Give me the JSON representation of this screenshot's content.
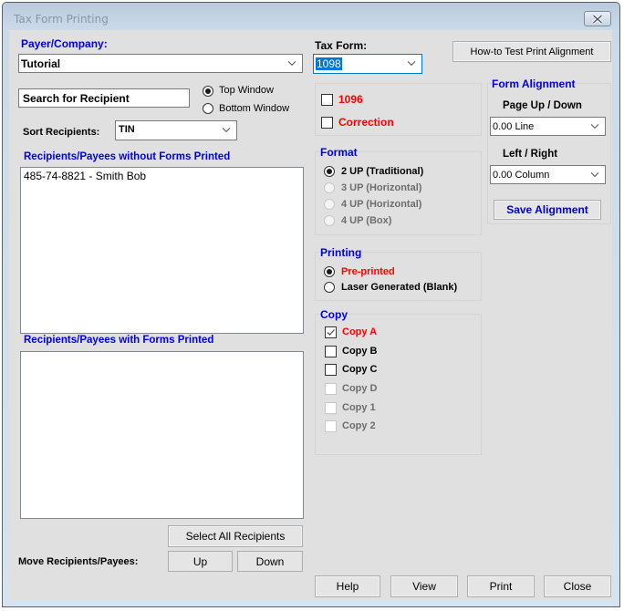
{
  "window": {
    "title": "Tax Form Printing",
    "close_icon": "close-icon"
  },
  "payer": {
    "label": "Payer/Company:",
    "value": "Tutorial"
  },
  "search": {
    "value": "Search for Recipient"
  },
  "target_window": {
    "options": [
      {
        "label": "Top Window",
        "selected": true
      },
      {
        "label": "Bottom Window",
        "selected": false
      }
    ]
  },
  "sort": {
    "label": "Sort Recipients:",
    "value": "TIN"
  },
  "list_without": {
    "label": "Recipients/Payees without Forms Printed",
    "items": [
      "485-74-8821 - Smith Bob"
    ]
  },
  "list_with": {
    "label": "Recipients/Payees with Forms Printed",
    "items": []
  },
  "select_all_label": "Select All Recipients",
  "move": {
    "label": "Move Recipients/Payees:",
    "up_label": "Up",
    "down_label": "Down"
  },
  "tax_form": {
    "label": "Tax Form:",
    "value": "1098"
  },
  "howto_label": "How-to Test Print  Alignment",
  "extras": {
    "items": [
      {
        "label": "1096",
        "checked": false
      },
      {
        "label": "Correction",
        "checked": false
      }
    ]
  },
  "format": {
    "title": "Format",
    "options": [
      {
        "label": "2 UP (Traditional)",
        "selected": true,
        "enabled": true
      },
      {
        "label": "3 UP (Horizontal)",
        "selected": false,
        "enabled": false
      },
      {
        "label": "4 UP (Horizontal)",
        "selected": false,
        "enabled": false
      },
      {
        "label": "4 UP (Box)",
        "selected": false,
        "enabled": false
      }
    ]
  },
  "printing": {
    "title": "Printing",
    "options": [
      {
        "label": "Pre-printed",
        "selected": true
      },
      {
        "label": "Laser Generated (Blank)",
        "selected": false
      }
    ]
  },
  "copy": {
    "title": "Copy",
    "items": [
      {
        "label": "Copy A",
        "checked": true,
        "enabled": true
      },
      {
        "label": "Copy B",
        "checked": false,
        "enabled": true
      },
      {
        "label": "Copy C",
        "checked": false,
        "enabled": true
      },
      {
        "label": "Copy D",
        "checked": false,
        "enabled": false
      },
      {
        "label": "Copy 1",
        "checked": false,
        "enabled": false
      },
      {
        "label": "Copy 2",
        "checked": false,
        "enabled": false
      }
    ]
  },
  "alignment": {
    "title": "Form Alignment",
    "page_label": "Page Up / Down",
    "page_value": "0.00 Line",
    "lr_label": "Left / Right",
    "lr_value": "0.00 Column",
    "save_label": "Save  Alignment"
  },
  "footer": {
    "help": "Help",
    "view": "View",
    "print": "Print",
    "close": "Close"
  },
  "colors": {
    "accent_label": "#0000e6",
    "required": "#ff0000",
    "selection": "#0078d7"
  }
}
